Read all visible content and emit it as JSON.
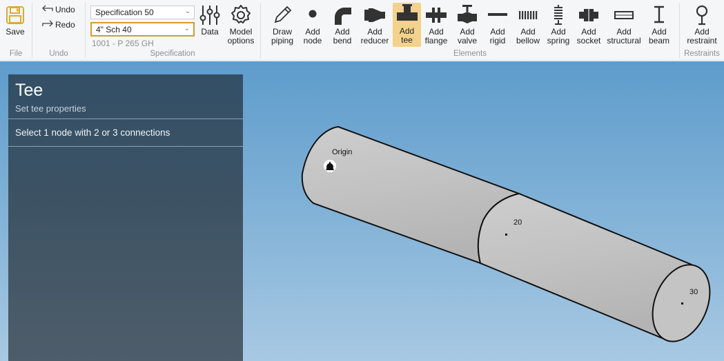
{
  "ribbon": {
    "file": {
      "group_label": "File",
      "save_label": "Save"
    },
    "undo": {
      "group_label": "Undo",
      "undo_label": "Undo",
      "redo_label": "Redo"
    },
    "specification": {
      "group_label": "Specification",
      "spec_value": "Specification 50",
      "pipe_value": "4\" Sch 40",
      "material_text": "1001 - P 265 GH",
      "data_label": "Data",
      "model_options_label": "Model options"
    },
    "elements": {
      "group_label": "Elements",
      "draw_piping": "Draw piping",
      "add_node": "Add node",
      "add_bend": "Add bend",
      "add_reducer": "Add reducer",
      "add_tee": "Add tee",
      "add_flange": "Add flange",
      "add_valve": "Add valve",
      "add_rigid": "Add rigid",
      "add_bellow": "Add bellow",
      "add_spring": "Add spring",
      "add_socket": "Add socket",
      "add_structural": "Add structural",
      "add_beam": "Add beam"
    },
    "restraints": {
      "group_label": "Restraints",
      "add_restraint": "Add restraint"
    }
  },
  "panel": {
    "title": "Tee",
    "subtitle": "Set tee properties",
    "instruction": "Select 1 node with 2 or 3 connections"
  },
  "viewport": {
    "origin_label": "Origin",
    "node_20": "20",
    "node_30": "30"
  },
  "colors": {
    "accent": "#d89a2f",
    "active_tool": "#f3d28c",
    "panel": "#3a5164",
    "pipe": "#c8c8c8"
  }
}
